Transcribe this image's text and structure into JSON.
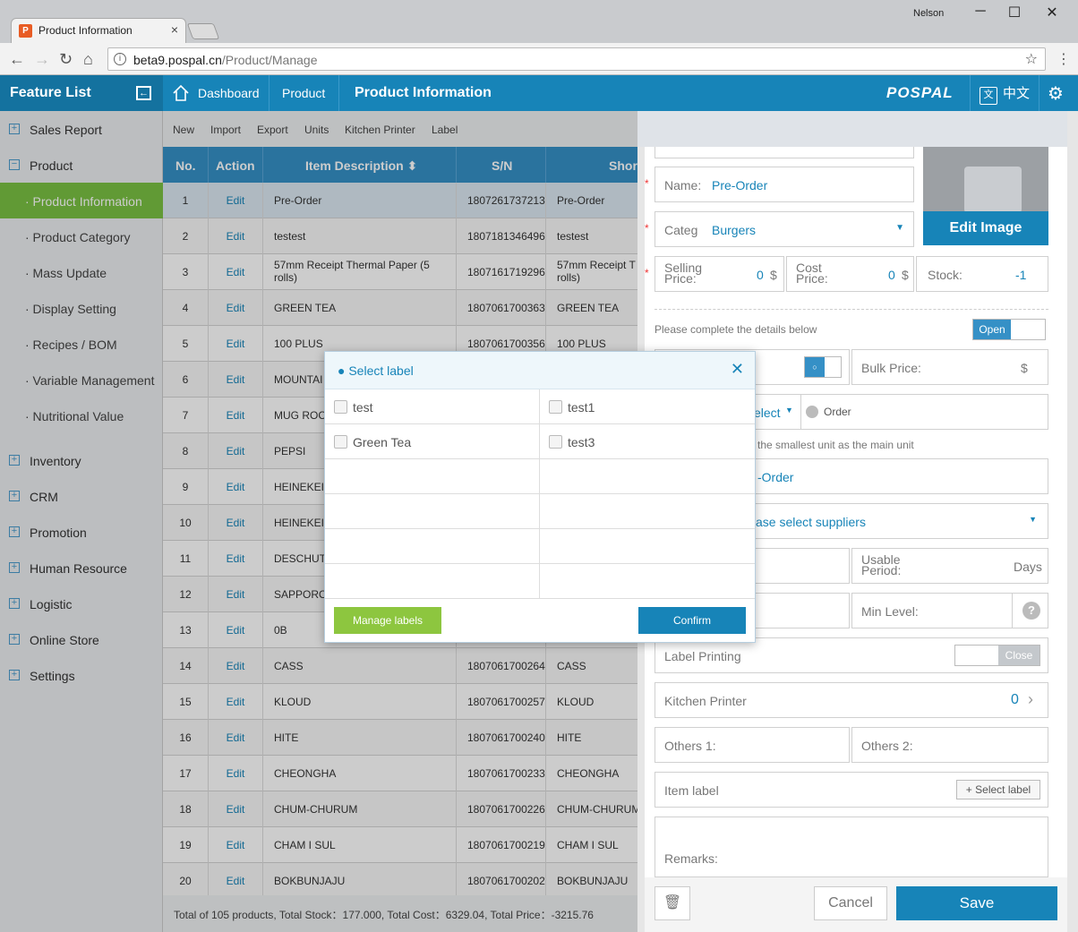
{
  "browser": {
    "tab_title": "Product Information",
    "tab_logo": "P",
    "user": "Nelson",
    "url_host": "beta9.pospal.cn",
    "url_path": "/Product/Manage"
  },
  "header": {
    "feature_list": "Feature List",
    "crumb_dashboard": "Dashboard",
    "crumb_product": "Product",
    "crumb_current": "Product Information",
    "brand": "POSPAL",
    "lang": "中文",
    "lang_icon": "文"
  },
  "sidebar": {
    "sales_report": "Sales Report",
    "product": "Product",
    "subs": [
      "· Product Information",
      "· Product Category",
      "· Mass Update",
      "· Display Setting",
      "· Recipes / BOM",
      "· Variable Management",
      "· Nutritional Value"
    ],
    "inventory": "Inventory",
    "crm": "CRM",
    "promotion": "Promotion",
    "human_resource": "Human Resource",
    "logistic": "Logistic",
    "online_store": "Online Store",
    "settings": "Settings"
  },
  "toolbar": {
    "new": "New",
    "import": "Import",
    "export": "Export",
    "units": "Units",
    "kitchen_printer": "Kitchen Printer",
    "label": "Label"
  },
  "table": {
    "headers": {
      "no": "No.",
      "action": "Action",
      "desc": "Item Description",
      "sn": "S/N",
      "short": "Shor"
    },
    "edit": "Edit",
    "rows": [
      {
        "no": "1",
        "desc": "Pre-Order",
        "sn": "1807261737213",
        "short": "Pre-Order"
      },
      {
        "no": "2",
        "desc": "testest",
        "sn": "1807181346496",
        "short": "testest"
      },
      {
        "no": "3",
        "desc": "57mm Receipt Thermal Paper (5 rolls)",
        "sn": "1807161719296",
        "short": "57mm Receipt T rolls)"
      },
      {
        "no": "4",
        "desc": "GREEN TEA",
        "sn": "1807061700363",
        "short": "GREEN TEA"
      },
      {
        "no": "5",
        "desc": "100 PLUS",
        "sn": "1807061700356",
        "short": "100 PLUS"
      },
      {
        "no": "6",
        "desc": "MOUNTAI",
        "sn": "",
        "short": ""
      },
      {
        "no": "7",
        "desc": "MUG ROC",
        "sn": "",
        "short": ""
      },
      {
        "no": "8",
        "desc": "PEPSI",
        "sn": "",
        "short": ""
      },
      {
        "no": "9",
        "desc": "HEINEKEI",
        "sn": "",
        "short": ""
      },
      {
        "no": "10",
        "desc": "HEINEKEI",
        "sn": "",
        "short": ""
      },
      {
        "no": "11",
        "desc": "DESCHUT",
        "sn": "",
        "short": ""
      },
      {
        "no": "12",
        "desc": "SAPPORO",
        "sn": "",
        "short": ""
      },
      {
        "no": "13",
        "desc": "0B",
        "sn": "",
        "short": ""
      },
      {
        "no": "14",
        "desc": "CASS",
        "sn": "1807061700264",
        "short": "CASS"
      },
      {
        "no": "15",
        "desc": "KLOUD",
        "sn": "1807061700257",
        "short": "KLOUD"
      },
      {
        "no": "16",
        "desc": "HITE",
        "sn": "1807061700240",
        "short": "HITE"
      },
      {
        "no": "17",
        "desc": "CHEONGHA",
        "sn": "1807061700233",
        "short": "CHEONGHA"
      },
      {
        "no": "18",
        "desc": "CHUM-CHURUM",
        "sn": "1807061700226",
        "short": "CHUM-CHURUM"
      },
      {
        "no": "19",
        "desc": "CHAM I SUL",
        "sn": "1807061700219",
        "short": "CHAM I SUL"
      },
      {
        "no": "20",
        "desc": "BOKBUNJAJU",
        "sn": "1807061700202",
        "short": "BOKBUNJAJU"
      }
    ],
    "footer": "Total of 105 products, Total Stock：177.000, Total Cost：6329.04, Total Price：-3215.76"
  },
  "panel": {
    "name_label": "Name:",
    "name_value": "Pre-Order",
    "category_label": "Categ",
    "category_value": "Burgers",
    "edit_image": "Edit Image",
    "selling_price_label": "Selling Price:",
    "selling_price_value": "0",
    "currency": "$",
    "cost_price_label": "Cost Price:",
    "cost_price_value": "0",
    "stock_label": "Stock:",
    "stock_value": "-1",
    "details_note": "Please complete the details below",
    "open_label": "Open",
    "toggle_small": "○",
    "bulk_price_label": "Bulk Price:",
    "select_partial": "elect",
    "order_label": "Order",
    "unit_note": "the smallest unit as the main unit",
    "barcode_partial": "-Order",
    "supplier_partial": "ase select suppliers",
    "usable_period_label": "Usable Period:",
    "days": "Days",
    "min_level_label": "Min Level:",
    "label_printing": "Label Printing",
    "close_label": "Close",
    "kitchen_printer": "Kitchen Printer",
    "kitchen_printer_value": "0",
    "others1": "Others 1:",
    "others2": "Others 2:",
    "item_label": "Item label",
    "select_label_btn": "+ Select label",
    "remarks": "Remarks:",
    "cancel": "Cancel",
    "save": "Save"
  },
  "modal": {
    "title": "● Select label",
    "labels": [
      "test",
      "test1",
      "Green Tea",
      "test3"
    ],
    "manage_labels": "Manage labels",
    "confirm": "Confirm"
  },
  "colors": {
    "accent": "#1784b8",
    "active_green": "#7ac143",
    "header_blue": "#3590c6"
  }
}
